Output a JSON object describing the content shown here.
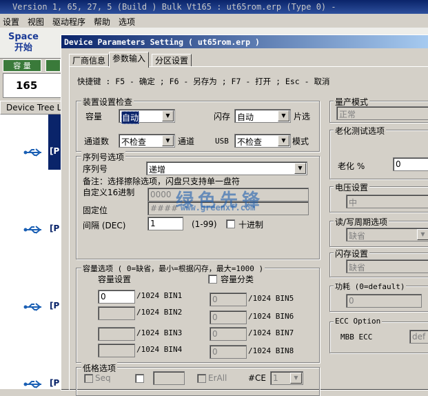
{
  "background_app": {
    "title": "Version 1, 65, 27, 5 (Build )  Bulk Vt165 : ut65rom.erp  (Type 0)  -",
    "menu": [
      "设置",
      "视图",
      "驱动程序",
      "帮助",
      "选项"
    ],
    "space_key": "Space",
    "space_label": "开始",
    "green_tab": "容 量",
    "count": "165",
    "device_tree_label": "Device Tree Li",
    "tree_item_label": "[P"
  },
  "dialog": {
    "title": "Device Parameters Setting ( ut65rom.erp )",
    "tabs": [
      "厂商信息",
      "参数输入",
      "分区设置"
    ],
    "shortcut_hint": "快捷键 : F5 - 确定 ; F6 - 另存为 ; F7 - 打开 ; Esc - 取消",
    "device_check": {
      "group_title": "装置设置检查",
      "capacity_label": "容量",
      "capacity_value": "自动",
      "flash_label": "闪存",
      "flash_value": "自动",
      "chip_select_label": "片选",
      "channel_count_label": "通道数",
      "channel_count_value": "不检查",
      "channel_label": "通道",
      "usb_label": "USB",
      "usb_value": "不检查",
      "mode_label": "模式"
    },
    "serial": {
      "group_title": "序列号选项",
      "serial_label": "序列号",
      "serial_value": "递增",
      "note": "备注：选择擦除选项，闪盘只支持单一盘符",
      "custom_hex_label": "自定义16进制",
      "custom_hex_value": "0000",
      "fixed_bits_label": "固定位",
      "fixed_bits_value": "####",
      "interval_label": "间隔 (DEC)",
      "interval_value": "1",
      "interval_range": "(1-99)",
      "decimal_label": "十进制"
    },
    "capacity": {
      "group_title": "容量选项 ( 0=缺省，最小=根据闪存，最大=1000 )",
      "settings_label": "容量设置",
      "classify_label": "容量分类",
      "bins": [
        {
          "value": "0",
          "label": "/1024 BIN1"
        },
        {
          "value": "",
          "label": "/1024 BIN2"
        },
        {
          "value": "",
          "label": "/1024 BIN3"
        },
        {
          "value": "",
          "label": "/1024 BIN4"
        },
        {
          "value": "0",
          "label": "/1024 BIN5"
        },
        {
          "value": "0",
          "label": "/1024 BIN6"
        },
        {
          "value": "0",
          "label": "/1024 BIN7"
        },
        {
          "value": "0",
          "label": "/1024 BIN8"
        }
      ]
    },
    "low_format": {
      "group_title": "低格选项",
      "seq_label": "Seq",
      "erall_label": "ErAll",
      "ce_label": "#CE",
      "ce_value": "1"
    },
    "right": {
      "mass_mode_title": "量产模式",
      "mass_mode_value": "正常",
      "aging_title": "老化测试选项",
      "aging_label": "老化 %",
      "aging_value": "0",
      "voltage_title": "电压设置",
      "voltage_value": "中",
      "rw_cycle_title": "读/写周期选项",
      "rw_cycle_value": "缺省",
      "flash_setting_title": "闪存设置",
      "flash_setting_value": "缺省",
      "power_title": "功耗 (0=default)",
      "power_value": "0",
      "ecc_title": "ECC Option",
      "ecc_label": "MBB ECC",
      "ecc_value": "def"
    }
  },
  "watermark": {
    "text": "绿色先锋",
    "url": "www.greenxf.com"
  }
}
